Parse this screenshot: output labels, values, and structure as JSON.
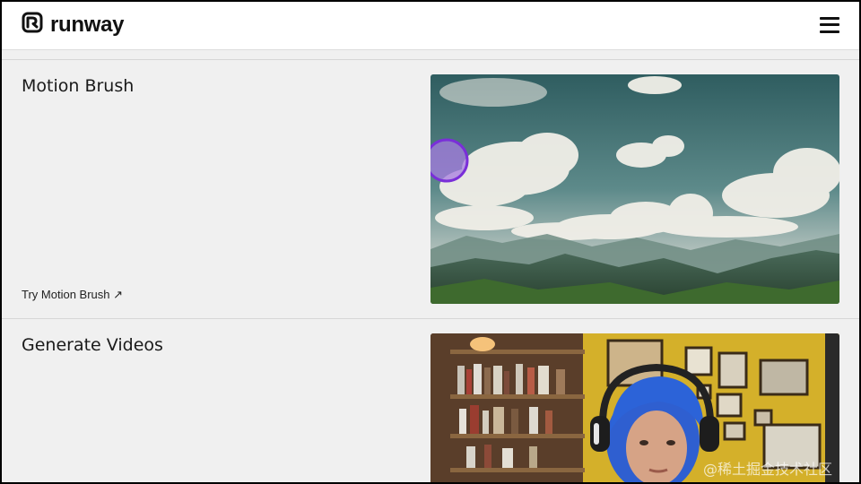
{
  "header": {
    "brand_name": "runway",
    "logo_icon": "runway-logo-icon",
    "menu_icon": "hamburger-menu-icon"
  },
  "sections": [
    {
      "title": "Motion Brush",
      "link_label": "Try Motion Brush ↗",
      "media": "landscape-clouds-mountains-image"
    },
    {
      "title": "Generate Videos",
      "link_label": "",
      "media": "woman-headphones-bookshelf-image"
    }
  ],
  "watermark": "@稀土掘金技术社区",
  "colors": {
    "background": "#f0f0f0",
    "header_bg": "#ffffff",
    "brush_accent": "#8a3fe0"
  }
}
